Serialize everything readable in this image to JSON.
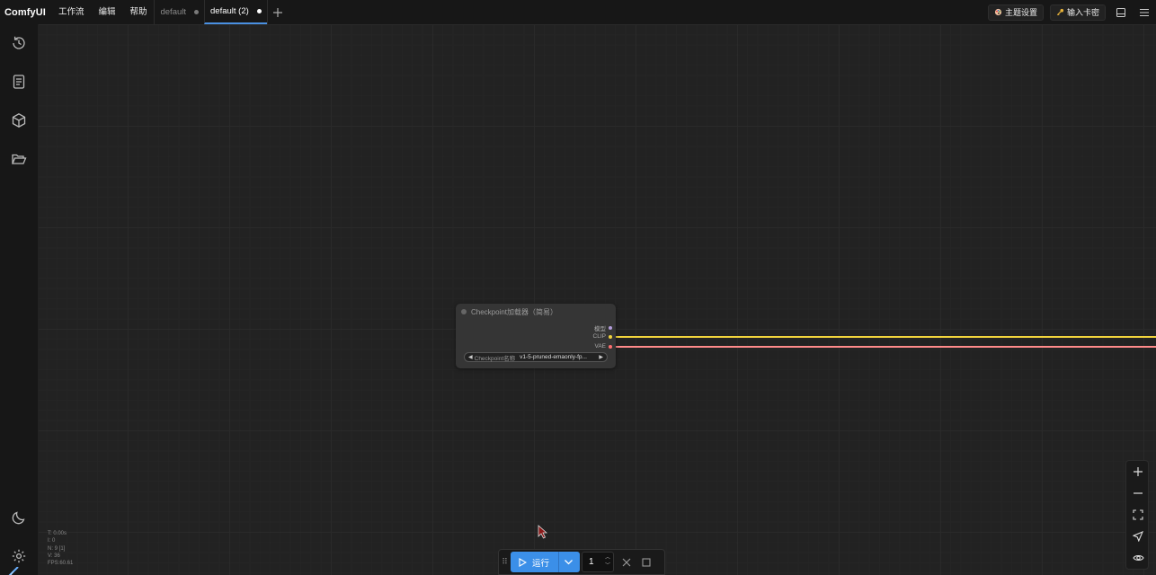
{
  "app": {
    "brand": "ComfyUI"
  },
  "menu": [
    "工作流",
    "编辑",
    "帮助"
  ],
  "tabs": [
    {
      "label": "default",
      "active": false
    },
    {
      "label": "default (2)",
      "active": true
    }
  ],
  "top_right": {
    "theme_label": "主题设置",
    "key_label": "输入卡密"
  },
  "sidebar_icons": [
    "history-icon",
    "document-icon",
    "cube-icon",
    "folder-open-icon",
    "moon-icon",
    "gear-icon"
  ],
  "node": {
    "title": "Checkpoint加载器（简易）",
    "outputs": [
      {
        "label": "模型",
        "color": "#b39ddb"
      },
      {
        "label": "CLIP",
        "color": "#f2d43c"
      },
      {
        "label": "VAE",
        "color": "#ff6e6e"
      }
    ],
    "widget": {
      "label": "Checkpoint名称",
      "value": "v1-5-pruned-emaonly-fp..."
    }
  },
  "links": {
    "clip_color": "#f2d43c",
    "vae_color": "#ff8a8a"
  },
  "stats": [
    "T: 0.00s",
    "I: 0",
    "N: 9 [1]",
    "V: 36",
    "FPS:60.61"
  ],
  "runbar": {
    "run_label": "运行",
    "count": "1"
  },
  "colors": {
    "accent": "#3b8fe8",
    "background": "#222222",
    "panel": "#171717"
  }
}
